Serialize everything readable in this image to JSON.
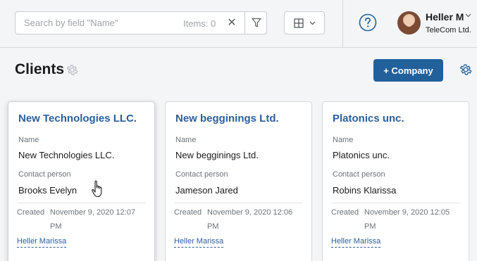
{
  "topbar": {
    "search": {
      "placeholder": "Search by field \"Name\"",
      "value": "",
      "items_count": "Items: 0"
    },
    "user": {
      "name": "Heller M",
      "company": "TeleCom Ltd."
    }
  },
  "page": {
    "title": "Clients",
    "add_button": "+ Company"
  },
  "labels": {
    "name": "Name",
    "contact": "Contact person",
    "created": "Created"
  },
  "cards": [
    {
      "title": "New Technologies LLC.",
      "name": "New Technologies LLC.",
      "contact": "Brooks Evelyn",
      "created": "November 9, 2020 12:07 PM",
      "author": "Heller Marissa"
    },
    {
      "title": "New begginings Ltd.",
      "name": "New begginings Ltd.",
      "contact": "Jameson Jared",
      "created": "November 9, 2020 12:06 PM",
      "author": "Heller Marissa"
    },
    {
      "title": "Platonics unc.",
      "name": "Platonics unc.",
      "contact": "Robins Klarissa",
      "created": "November 9, 2020 12:05 PM",
      "author": "Heller Marissa"
    }
  ],
  "colors": {
    "accent": "#22609b",
    "link": "#2b5f9a",
    "background": "#f4f5f7"
  },
  "icons": [
    "clear-icon",
    "filter-icon",
    "grid-view-icon",
    "chevron-down-icon",
    "help-icon",
    "gear-icon",
    "hand-cursor-icon"
  ]
}
